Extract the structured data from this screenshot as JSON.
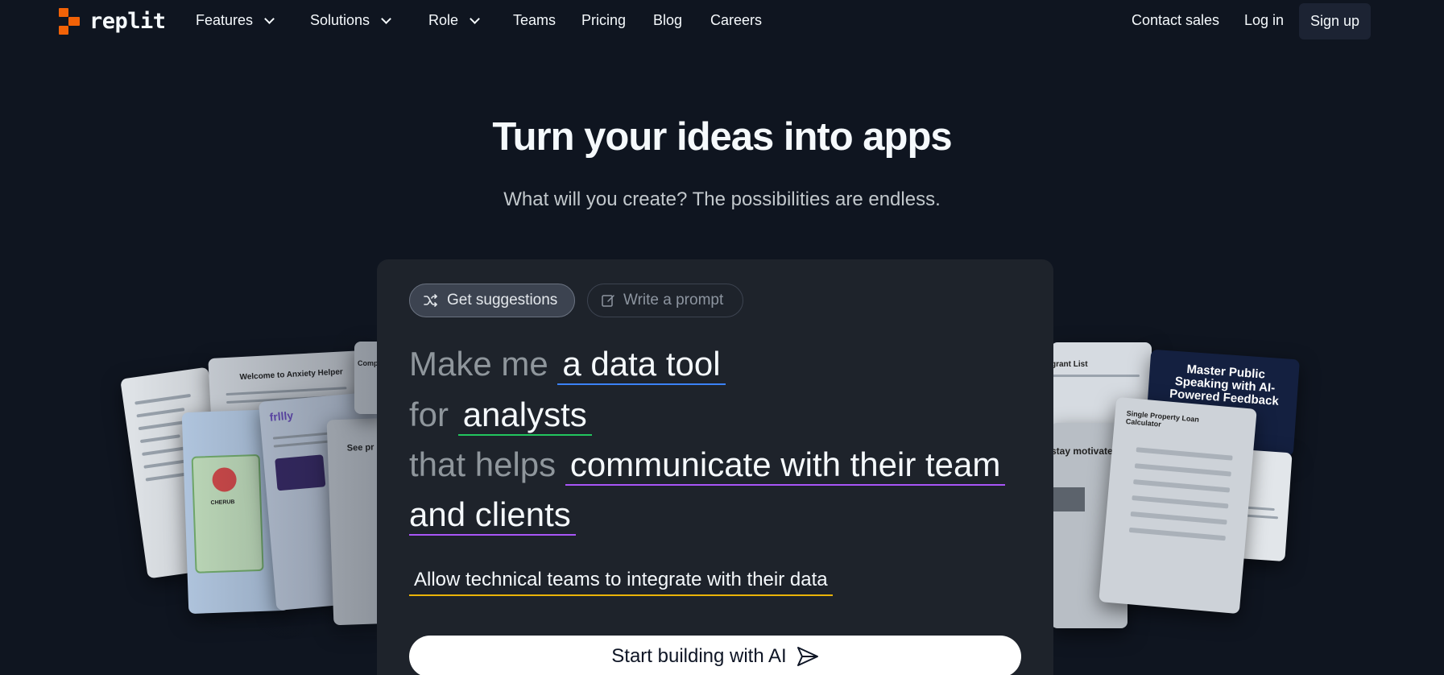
{
  "nav": {
    "logo_text": "replit",
    "items": [
      {
        "label": "Features"
      },
      {
        "label": "Solutions"
      },
      {
        "label": "Role"
      },
      {
        "label": "Teams"
      },
      {
        "label": "Pricing"
      },
      {
        "label": "Blog"
      },
      {
        "label": "Careers"
      }
    ],
    "contact_sales": "Contact sales",
    "log_in": "Log in",
    "sign_up": "Sign up"
  },
  "hero": {
    "title": "Turn your ideas into apps",
    "subtitle": "What will you create? The possibilities are endless."
  },
  "prompt_builder": {
    "tab_suggestions": "Get suggestions",
    "tab_write": "Write a prompt",
    "line1_prefix": "Make me",
    "line1_value": "a data tool",
    "line2_prefix": "for",
    "line2_value": "analysts",
    "line3_prefix": "that helps",
    "line3_value": "communicate with their team",
    "line4_value": "and clients",
    "feature_hint": "Allow technical teams to integrate with their data",
    "cta_label": "Start building with AI"
  },
  "showcase": {
    "left_cards": [
      {
        "title": "Welcome to Anxiety Helper"
      },
      {
        "title": "frllly"
      },
      {
        "title": "See pr"
      },
      {
        "title": "Comp"
      },
      {
        "title": "CHERUB"
      }
    ],
    "right_cards": [
      {
        "title": "grant List"
      },
      {
        "title": "Single Property Loan Calculator"
      },
      {
        "title": "stay motivated"
      },
      {
        "title": "Master Public Speaking with AI-Powered Feedback"
      }
    ]
  },
  "colors": {
    "background": "#0f1520",
    "accent_orange": "#f26207",
    "blue_underline": "#3b82f6",
    "green_underline": "#22c55e",
    "purple_underline": "#a855f7",
    "yellow_underline": "#eab308"
  }
}
